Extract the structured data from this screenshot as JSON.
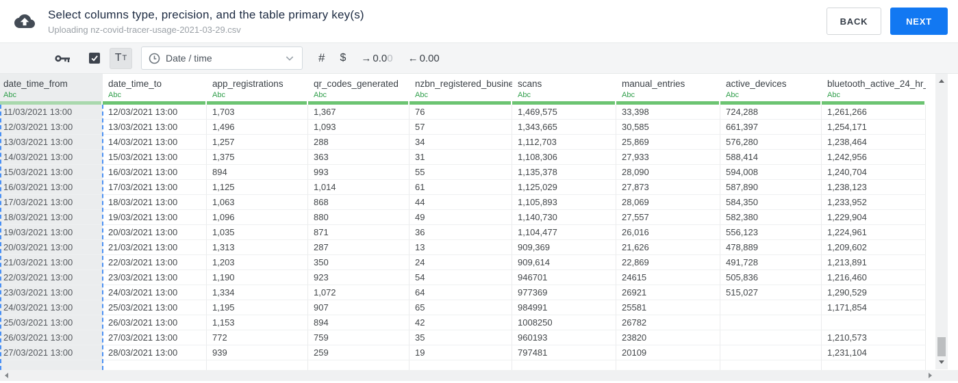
{
  "header": {
    "title": "Select columns type, precision, and the table primary key(s)",
    "subtitle": "Uploading nz-covid-tracer-usage-2021-03-29.csv",
    "back_label": "BACK",
    "next_label": "NEXT"
  },
  "toolbar": {
    "checkbox_checked": true,
    "text_type": {
      "big": "T",
      "small": "T"
    },
    "type_dropdown_value": "Date / time",
    "number_label": "#",
    "currency_label": "$",
    "decimal_right": {
      "arrow": "→",
      "main": "0.0",
      "faded": "0"
    },
    "decimal_left": {
      "arrow": "←",
      "main": "0.00"
    }
  },
  "table": {
    "columns": [
      {
        "name": "date_time_from",
        "type": "Abc",
        "selected": true
      },
      {
        "name": "date_time_to",
        "type": "Abc",
        "selected": false
      },
      {
        "name": "app_registrations",
        "type": "Abc",
        "selected": false
      },
      {
        "name": "qr_codes_generated",
        "type": "Abc",
        "selected": false
      },
      {
        "name": "nzbn_registered_busine",
        "type": "Abc",
        "selected": false
      },
      {
        "name": "scans",
        "type": "Abc",
        "selected": false
      },
      {
        "name": "manual_entries",
        "type": "Abc",
        "selected": false
      },
      {
        "name": "active_devices",
        "type": "Abc",
        "selected": false
      },
      {
        "name": "bluetooth_active_24_hr_",
        "type": "Abc",
        "selected": false
      }
    ],
    "rows": [
      [
        "11/03/2021 13:00",
        "12/03/2021 13:00",
        "1,703",
        "1,367",
        "76",
        "1,469,575",
        "33,398",
        "724,288",
        "1,261,266"
      ],
      [
        "12/03/2021 13:00",
        "13/03/2021 13:00",
        "1,496",
        "1,093",
        "57",
        "1,343,665",
        "30,585",
        "661,397",
        "1,254,171"
      ],
      [
        "13/03/2021 13:00",
        "14/03/2021 13:00",
        "1,257",
        "288",
        "34",
        "1,112,703",
        "25,869",
        "576,280",
        "1,238,464"
      ],
      [
        "14/03/2021 13:00",
        "15/03/2021 13:00",
        "1,375",
        "363",
        "31",
        "1,108,306",
        "27,933",
        "588,414",
        "1,242,956"
      ],
      [
        "15/03/2021 13:00",
        "16/03/2021 13:00",
        "894",
        "993",
        "55",
        "1,135,378",
        "28,090",
        "594,008",
        "1,240,704"
      ],
      [
        "16/03/2021 13:00",
        "17/03/2021 13:00",
        "1,125",
        "1,014",
        "61",
        "1,125,029",
        "27,873",
        "587,890",
        "1,238,123"
      ],
      [
        "17/03/2021 13:00",
        "18/03/2021 13:00",
        "1,063",
        "868",
        "44",
        "1,105,893",
        "28,069",
        "584,350",
        "1,233,952"
      ],
      [
        "18/03/2021 13:00",
        "19/03/2021 13:00",
        "1,096",
        "880",
        "49",
        "1,140,730",
        "27,557",
        "582,380",
        "1,229,904"
      ],
      [
        "19/03/2021 13:00",
        "20/03/2021 13:00",
        "1,035",
        "871",
        "36",
        "1,104,477",
        "26,016",
        "556,123",
        "1,224,961"
      ],
      [
        "20/03/2021 13:00",
        "21/03/2021 13:00",
        "1,313",
        "287",
        "13",
        "909,369",
        "21,626",
        "478,889",
        "1,209,602"
      ],
      [
        "21/03/2021 13:00",
        "22/03/2021 13:00",
        "1,203",
        "350",
        "24",
        "909,614",
        "22,869",
        "491,728",
        "1,213,891"
      ],
      [
        "22/03/2021 13:00",
        "23/03/2021 13:00",
        "1,190",
        "923",
        "54",
        "946701",
        "24615",
        "505,836",
        "1,216,460"
      ],
      [
        "23/03/2021 13:00",
        "24/03/2021 13:00",
        "1,334",
        "1,072",
        "64",
        "977369",
        "26921",
        "515,027",
        "1,290,529"
      ],
      [
        "24/03/2021 13:00",
        "25/03/2021 13:00",
        "1,195",
        "907",
        "65",
        "984991",
        "25581",
        "",
        "1,171,854"
      ],
      [
        "25/03/2021 13:00",
        "26/03/2021 13:00",
        "1,153",
        "894",
        "42",
        "1008250",
        "26782",
        "",
        ""
      ],
      [
        "26/03/2021 13:00",
        "27/03/2021 13:00",
        "772",
        "759",
        "35",
        "960193",
        "23820",
        "",
        "1,210,573"
      ],
      [
        "27/03/2021 13:00",
        "28/03/2021 13:00",
        "939",
        "259",
        "19",
        "797481",
        "20109",
        "",
        "1,231,104"
      ]
    ]
  },
  "colors": {
    "accent_blue": "#1278f2",
    "type_label_green": "#2f9e4a",
    "underline_green": "#6cc472",
    "underline_green_selected": "#a9d8ad",
    "selection_dash_blue": "#4a90f4",
    "toolbar_icon_dark": "#3d434d"
  }
}
